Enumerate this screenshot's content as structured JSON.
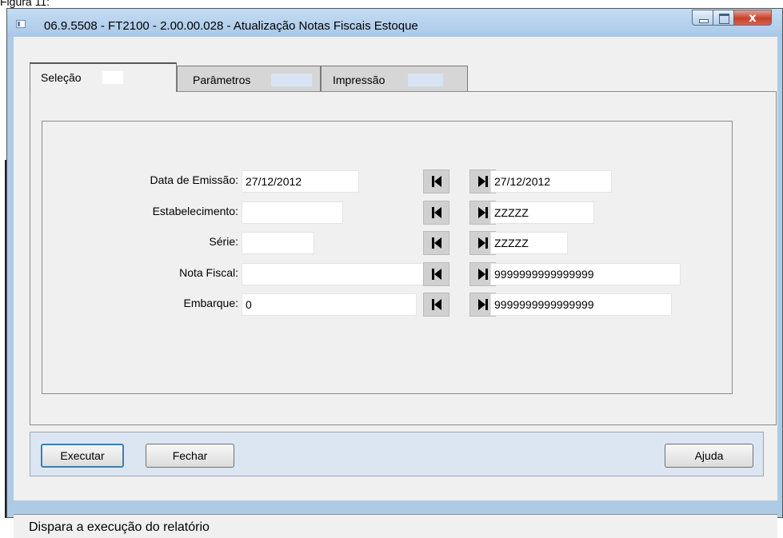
{
  "caption": "Figura 11:",
  "window": {
    "title": "06.9.5508 - FT2100 - 2.00.00.028 - Atualização Notas Fiscais Estoque",
    "icons": {
      "minimize": "minimize-icon",
      "maximize": "maximize-icon",
      "close": "close-icon"
    },
    "close_glyph": "x"
  },
  "tabs": [
    {
      "label": "Seleção",
      "active": true
    },
    {
      "label": "Parâmetros",
      "active": false
    },
    {
      "label": "Impressão",
      "active": false
    }
  ],
  "form": {
    "rows": [
      {
        "label": "Data de Emissão:",
        "from": "27/12/2012",
        "to": "27/12/2012"
      },
      {
        "label": "Estabelecimento:",
        "from": "",
        "to": "ZZZZZ"
      },
      {
        "label": "Série:",
        "from": "",
        "to": "ZZZZZ"
      },
      {
        "label": "Nota Fiscal:",
        "from": "",
        "to": "9999999999999999"
      },
      {
        "label": "Embarque:",
        "from": "0",
        "to": "9999999999999999"
      }
    ],
    "nav_icons": {
      "first": "skip-to-first-icon",
      "last": "skip-to-last-icon"
    }
  },
  "buttons": {
    "execute": "Executar",
    "close": "Fechar",
    "help": "Ajuda"
  },
  "status": {
    "text": "Dispara a execução do relatório"
  },
  "colors": {
    "window_frame": "#aecbe6",
    "client": "#f0f0f0",
    "button_bar": "#dbe6f2",
    "close_button": "#c8422b"
  }
}
